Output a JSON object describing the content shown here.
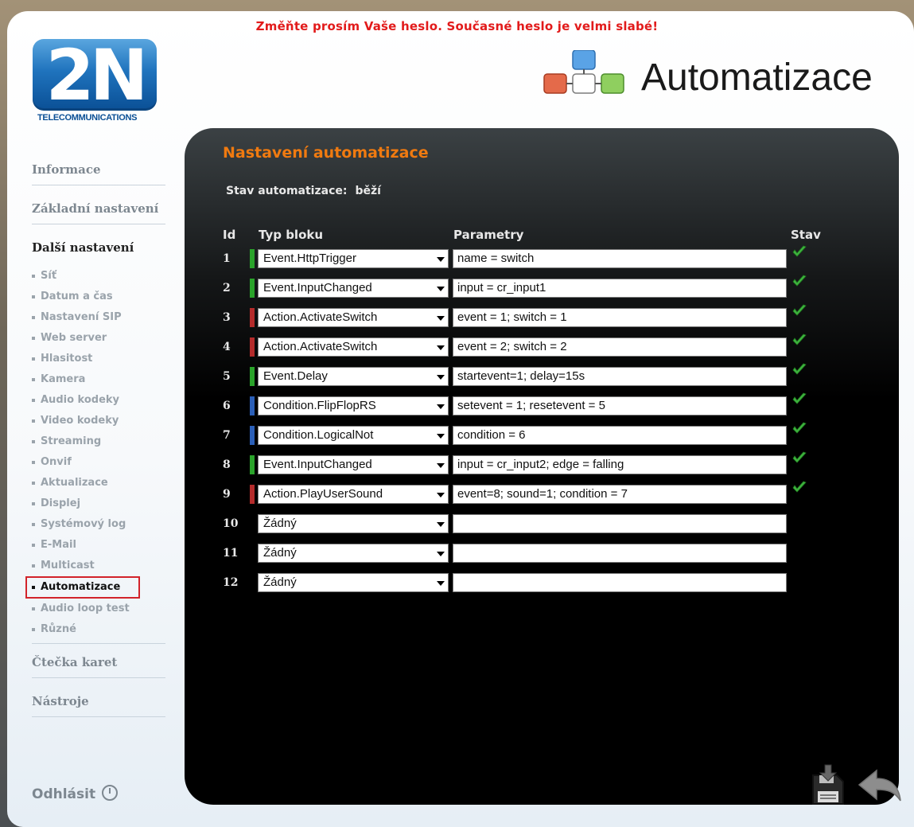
{
  "warning": "Změňte prosím Vaše heslo. Současné heslo je velmi slabé!",
  "logo": {
    "mark": "2N",
    "subtitle": "TELECOMMUNICATIONS"
  },
  "header": {
    "title": "Automatizace",
    "icon": "automation-blocks-icon"
  },
  "sidebar": {
    "sections": [
      {
        "label": "Informace"
      },
      {
        "label": "Základní nastavení"
      },
      {
        "label": "Další nastavení"
      }
    ],
    "items": [
      {
        "label": "Síť"
      },
      {
        "label": "Datum a čas"
      },
      {
        "label": "Nastavení SIP"
      },
      {
        "label": "Web server"
      },
      {
        "label": "Hlasitost"
      },
      {
        "label": "Kamera"
      },
      {
        "label": "Audio kodeky"
      },
      {
        "label": "Video kodeky"
      },
      {
        "label": "Streaming"
      },
      {
        "label": "Onvif"
      },
      {
        "label": "Aktualizace"
      },
      {
        "label": "Displej"
      },
      {
        "label": "Systémový log"
      },
      {
        "label": "E-Mail"
      },
      {
        "label": "Multicast"
      },
      {
        "label": "Automatizace"
      },
      {
        "label": "Audio loop test"
      },
      {
        "label": "Různé"
      }
    ],
    "sections_after": [
      {
        "label": "Čtečka karet"
      },
      {
        "label": "Nástroje"
      }
    ],
    "logout": "Odhlásit"
  },
  "main": {
    "title": "Nastavení automatizace",
    "status_label": "Stav automatizace:",
    "status_value": "běží",
    "columns": {
      "id": "Id",
      "type": "Typ bloku",
      "params": "Parametry",
      "state": "Stav"
    },
    "rows": [
      {
        "id": "1",
        "type": "Event.HttpTrigger",
        "params": "name = switch",
        "color": "#2aa32a",
        "ok": true
      },
      {
        "id": "2",
        "type": "Event.InputChanged",
        "params": "input = cr_input1",
        "color": "#2aa32a",
        "ok": true
      },
      {
        "id": "3",
        "type": "Action.ActivateSwitch",
        "params": "event = 1; switch = 1",
        "color": "#b42b2b",
        "ok": true
      },
      {
        "id": "4",
        "type": "Action.ActivateSwitch",
        "params": "event = 2; switch = 2",
        "color": "#b42b2b",
        "ok": true
      },
      {
        "id": "5",
        "type": "Event.Delay",
        "params": "startevent=1; delay=15s",
        "color": "#2aa32a",
        "ok": true
      },
      {
        "id": "6",
        "type": "Condition.FlipFlopRS",
        "params": "setevent = 1; resetevent = 5",
        "color": "#2b5fb8",
        "ok": true
      },
      {
        "id": "7",
        "type": "Condition.LogicalNot",
        "params": "condition = 6",
        "color": "#2b5fb8",
        "ok": true
      },
      {
        "id": "8",
        "type": "Event.InputChanged",
        "params": "input = cr_input2; edge = falling",
        "color": "#2aa32a",
        "ok": true
      },
      {
        "id": "9",
        "type": "Action.PlayUserSound",
        "params": "event=8; sound=1; condition = 7",
        "color": "#b42b2b",
        "ok": true
      },
      {
        "id": "10",
        "type": "Žádný",
        "params": "",
        "color": "",
        "ok": false
      },
      {
        "id": "11",
        "type": "Žádný",
        "params": "",
        "color": "",
        "ok": false
      },
      {
        "id": "12",
        "type": "Žádný",
        "params": "",
        "color": "",
        "ok": false
      }
    ]
  },
  "toolbar": {
    "save_icon": "save-icon",
    "back_icon": "back-arrow-icon"
  }
}
